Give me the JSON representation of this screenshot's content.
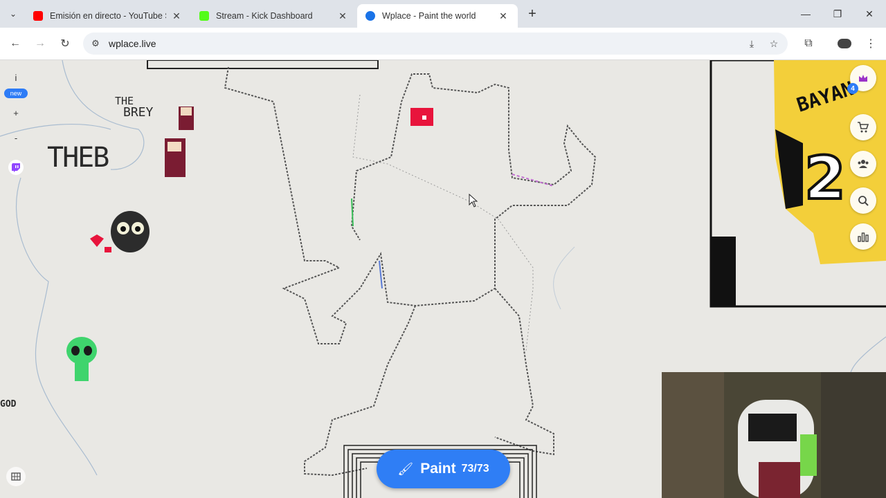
{
  "browser": {
    "tabs": [
      {
        "title": "Emisión en directo - YouTube S",
        "favicon_color": "#ff0000",
        "active": false
      },
      {
        "title": "Stream - Kick Dashboard",
        "favicon_color": "#53fc18",
        "active": false
      },
      {
        "title": "Wplace - Paint the world",
        "favicon_color": "#1a73e8",
        "active": true
      }
    ],
    "address": {
      "url": "wplace.live"
    },
    "icons": {
      "tab_search": "chevron-down-icon",
      "new_tab": "plus-icon",
      "back": "arrow-left-icon",
      "forward": "arrow-right-icon",
      "reload": "reload-icon",
      "site_info": "tune-icon",
      "install": "install-icon",
      "bookmark": "star-icon",
      "extensions": "puzzle-icon",
      "profile": "avatar-icon",
      "menu": "more-vert-icon"
    }
  },
  "app": {
    "left_toolbar": {
      "info_label": "i",
      "new_badge": "new",
      "zoom_in": "+",
      "zoom_out": "-"
    },
    "right_toolbar": {
      "notification_count": "4"
    },
    "paint_button": {
      "label": "Paint",
      "charges": "73/73"
    },
    "canvas_text": {
      "tag_the": "THE",
      "tag_brey": "BREY",
      "tag_theb": "THEB",
      "tag_god": "GOD"
    },
    "accent_color": "#2f7ef5"
  }
}
